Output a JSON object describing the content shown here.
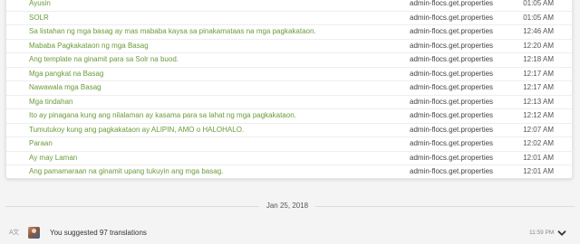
{
  "log_rows": [
    {
      "message": "Ayusin",
      "resource": "admin-flocs.get.properties",
      "time": "01:05 AM"
    },
    {
      "message": "SOLR",
      "resource": "admin-flocs.get.properties",
      "time": "01:05 AM"
    },
    {
      "message": "Sa listahan ng mga basag ay mas mababa kaysa sa pinakamataas na mga pagkakataon.",
      "resource": "admin-flocs.get.properties",
      "time": "12:46 AM"
    },
    {
      "message": "Mababa Pagkakataon ng mga Basag",
      "resource": "admin-flocs.get.properties",
      "time": "12:20 AM"
    },
    {
      "message": "Ang template na ginamit para sa Solr na buod.",
      "resource": "admin-flocs.get.properties",
      "time": "12:18 AM"
    },
    {
      "message": "Mga pangkat na Basag",
      "resource": "admin-flocs.get.properties",
      "time": "12:17 AM"
    },
    {
      "message": "Nawawala mga Basag",
      "resource": "admin-flocs.get.properties",
      "time": "12:17 AM"
    },
    {
      "message": "Mga tindahan",
      "resource": "admin-flocs.get.properties",
      "time": "12:13 AM"
    },
    {
      "message": "Ito ay pinagana kung ang nilalaman ay kasama para sa lahat ng mga pagkakataon.",
      "resource": "admin-flocs.get.properties",
      "time": "12:12 AM"
    },
    {
      "message": "Tumutukoy kung ang pagkakataon ay ALIPIN, AMO o HALOHALO.",
      "resource": "admin-flocs.get.properties",
      "time": "12:07 AM"
    },
    {
      "message": "Paraan",
      "resource": "admin-flocs.get.properties",
      "time": "12:02 AM"
    },
    {
      "message": "Ay may Laman",
      "resource": "admin-flocs.get.properties",
      "time": "12:01 AM"
    },
    {
      "message": "Ang pamamaraan na ginamit upang tukuyin ang mga basag.",
      "resource": "admin-flocs.get.properties",
      "time": "12:01 AM"
    }
  ],
  "date_separator": "Jan 25, 2018",
  "activity": {
    "lang_icon": "A文",
    "text": "You suggested 97 translations",
    "time": "11:59 PM",
    "expand_icon": "chevron-down-icon"
  },
  "colors": {
    "link_green": "#6b9b3a",
    "card_bg": "#ffffff",
    "page_bg": "#f4f4f4"
  }
}
